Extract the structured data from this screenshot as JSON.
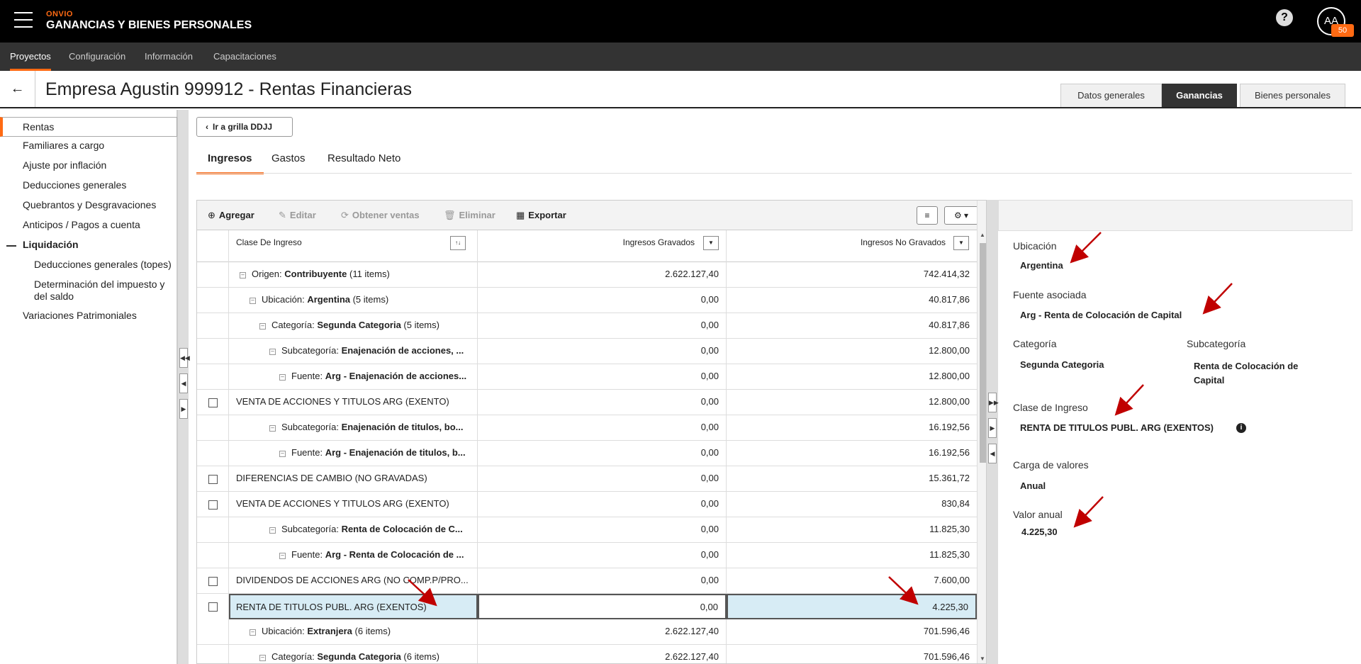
{
  "header": {
    "brand_small": "ONVIO",
    "brand_title": "GANANCIAS Y BIENES PERSONALES",
    "help_icon": "?",
    "avatar_initials": "AA",
    "avatar_badge": "50"
  },
  "nav": {
    "items": [
      "Proyectos",
      "Configuración",
      "Información",
      "Capacitaciones"
    ]
  },
  "page": {
    "title": "Empresa Agustin 999912 - Rentas Financieras",
    "tabs": [
      "Datos generales",
      "Ganancias",
      "Bienes personales"
    ]
  },
  "sidebar": {
    "items": [
      "Rentas",
      "Familiares a cargo",
      "Ajuste por inflación",
      "Deducciones generales",
      "Quebrantos y Desgravaciones",
      "Anticipos / Pagos a cuenta",
      "Liquidación",
      "Deducciones generales (topes)",
      "Determinación del impuesto y del saldo",
      "Variaciones Patrimoniales"
    ]
  },
  "main": {
    "back_button": "Ir a grilla DDJJ",
    "tabs": [
      "Ingresos",
      "Gastos",
      "Resultado Neto"
    ]
  },
  "toolbar": {
    "add": "Agregar",
    "edit": "Editar",
    "get_sales": "Obtener ventas",
    "delete": "Eliminar",
    "export": "Exportar"
  },
  "grid": {
    "columns": [
      "Clase De Ingreso",
      "Ingresos Gravados",
      "Ingresos No Gravados"
    ],
    "rows": [
      {
        "prefix": "Origen: ",
        "bold": "Contribuyente",
        "suffix": " (11 items)",
        "gravados": "2.622.127,40",
        "no_gravados": "742.414,32"
      },
      {
        "prefix": "Ubicación: ",
        "bold": "Argentina",
        "suffix": " (5 items)",
        "gravados": "0,00",
        "no_gravados": "40.817,86"
      },
      {
        "prefix": "Categoría: ",
        "bold": "Segunda Categoria",
        "suffix": " (5 items)",
        "gravados": "0,00",
        "no_gravados": "40.817,86"
      },
      {
        "prefix": "Subcategoría: ",
        "bold": "Enajenación de acciones, ...",
        "suffix": "",
        "gravados": "0,00",
        "no_gravados": "12.800,00"
      },
      {
        "prefix": "Fuente: ",
        "bold": "Arg - Enajenación de acciones...",
        "suffix": "",
        "gravados": "0,00",
        "no_gravados": "12.800,00"
      },
      {
        "prefix": "VENTA DE ACCIONES Y TITULOS ARG (EXENTO)",
        "bold": "",
        "suffix": "",
        "gravados": "0,00",
        "no_gravados": "12.800,00"
      },
      {
        "prefix": "Subcategoría: ",
        "bold": "Enajenación de titulos, bo...",
        "suffix": "",
        "gravados": "0,00",
        "no_gravados": "16.192,56"
      },
      {
        "prefix": "Fuente: ",
        "bold": "Arg - Enajenación de titulos, b...",
        "suffix": "",
        "gravados": "0,00",
        "no_gravados": "16.192,56"
      },
      {
        "prefix": "DIFERENCIAS DE CAMBIO (NO GRAVADAS)",
        "bold": "",
        "suffix": "",
        "gravados": "0,00",
        "no_gravados": "15.361,72"
      },
      {
        "prefix": "VENTA DE ACCIONES Y TITULOS ARG (EXENTO)",
        "bold": "",
        "suffix": "",
        "gravados": "0,00",
        "no_gravados": "830,84"
      },
      {
        "prefix": "Subcategoría: ",
        "bold": "Renta de Colocación de C...",
        "suffix": "",
        "gravados": "0,00",
        "no_gravados": "11.825,30"
      },
      {
        "prefix": "Fuente: ",
        "bold": "Arg - Renta de Colocación de ...",
        "suffix": "",
        "gravados": "0,00",
        "no_gravados": "11.825,30"
      },
      {
        "prefix": "DIVIDENDOS DE ACCIONES ARG (NO COMP.P/PRO...",
        "bold": "",
        "suffix": "",
        "gravados": "0,00",
        "no_gravados": "7.600,00"
      },
      {
        "prefix": "RENTA DE TITULOS PUBL. ARG (EXENTOS)",
        "bold": "",
        "suffix": "",
        "gravados": "0,00",
        "no_gravados": "4.225,30"
      },
      {
        "prefix": "Ubicación: ",
        "bold": "Extranjera",
        "suffix": " (6 items)",
        "gravados": "2.622.127,40",
        "no_gravados": "701.596,46"
      },
      {
        "prefix": "Categoría: ",
        "bold": "Segunda Categoria",
        "suffix": " (6 items)",
        "gravados": "2.622.127,40",
        "no_gravados": "701.596,46"
      }
    ]
  },
  "detail": {
    "ubicacion_label": "Ubicación",
    "ubicacion": "Argentina",
    "fuente_label": "Fuente asociada",
    "fuente": "Arg - Renta de Colocación de Capital",
    "categoria_label": "Categoría",
    "categoria": "Segunda Categoria",
    "subcategoria_label": "Subcategoría",
    "subcategoria": "Renta de Colocación de Capital",
    "clase_label": "Clase de Ingreso",
    "clase": "RENTA DE TITULOS PUBL. ARG (EXENTOS)",
    "carga_label": "Carga de valores",
    "carga": "Anual",
    "valor_label": "Valor anual",
    "valor": "4.225,30"
  },
  "colors": {
    "accent": "#ff6a13",
    "annotation_arrow": "#c00000",
    "selected_row": "#d7ecf5"
  }
}
